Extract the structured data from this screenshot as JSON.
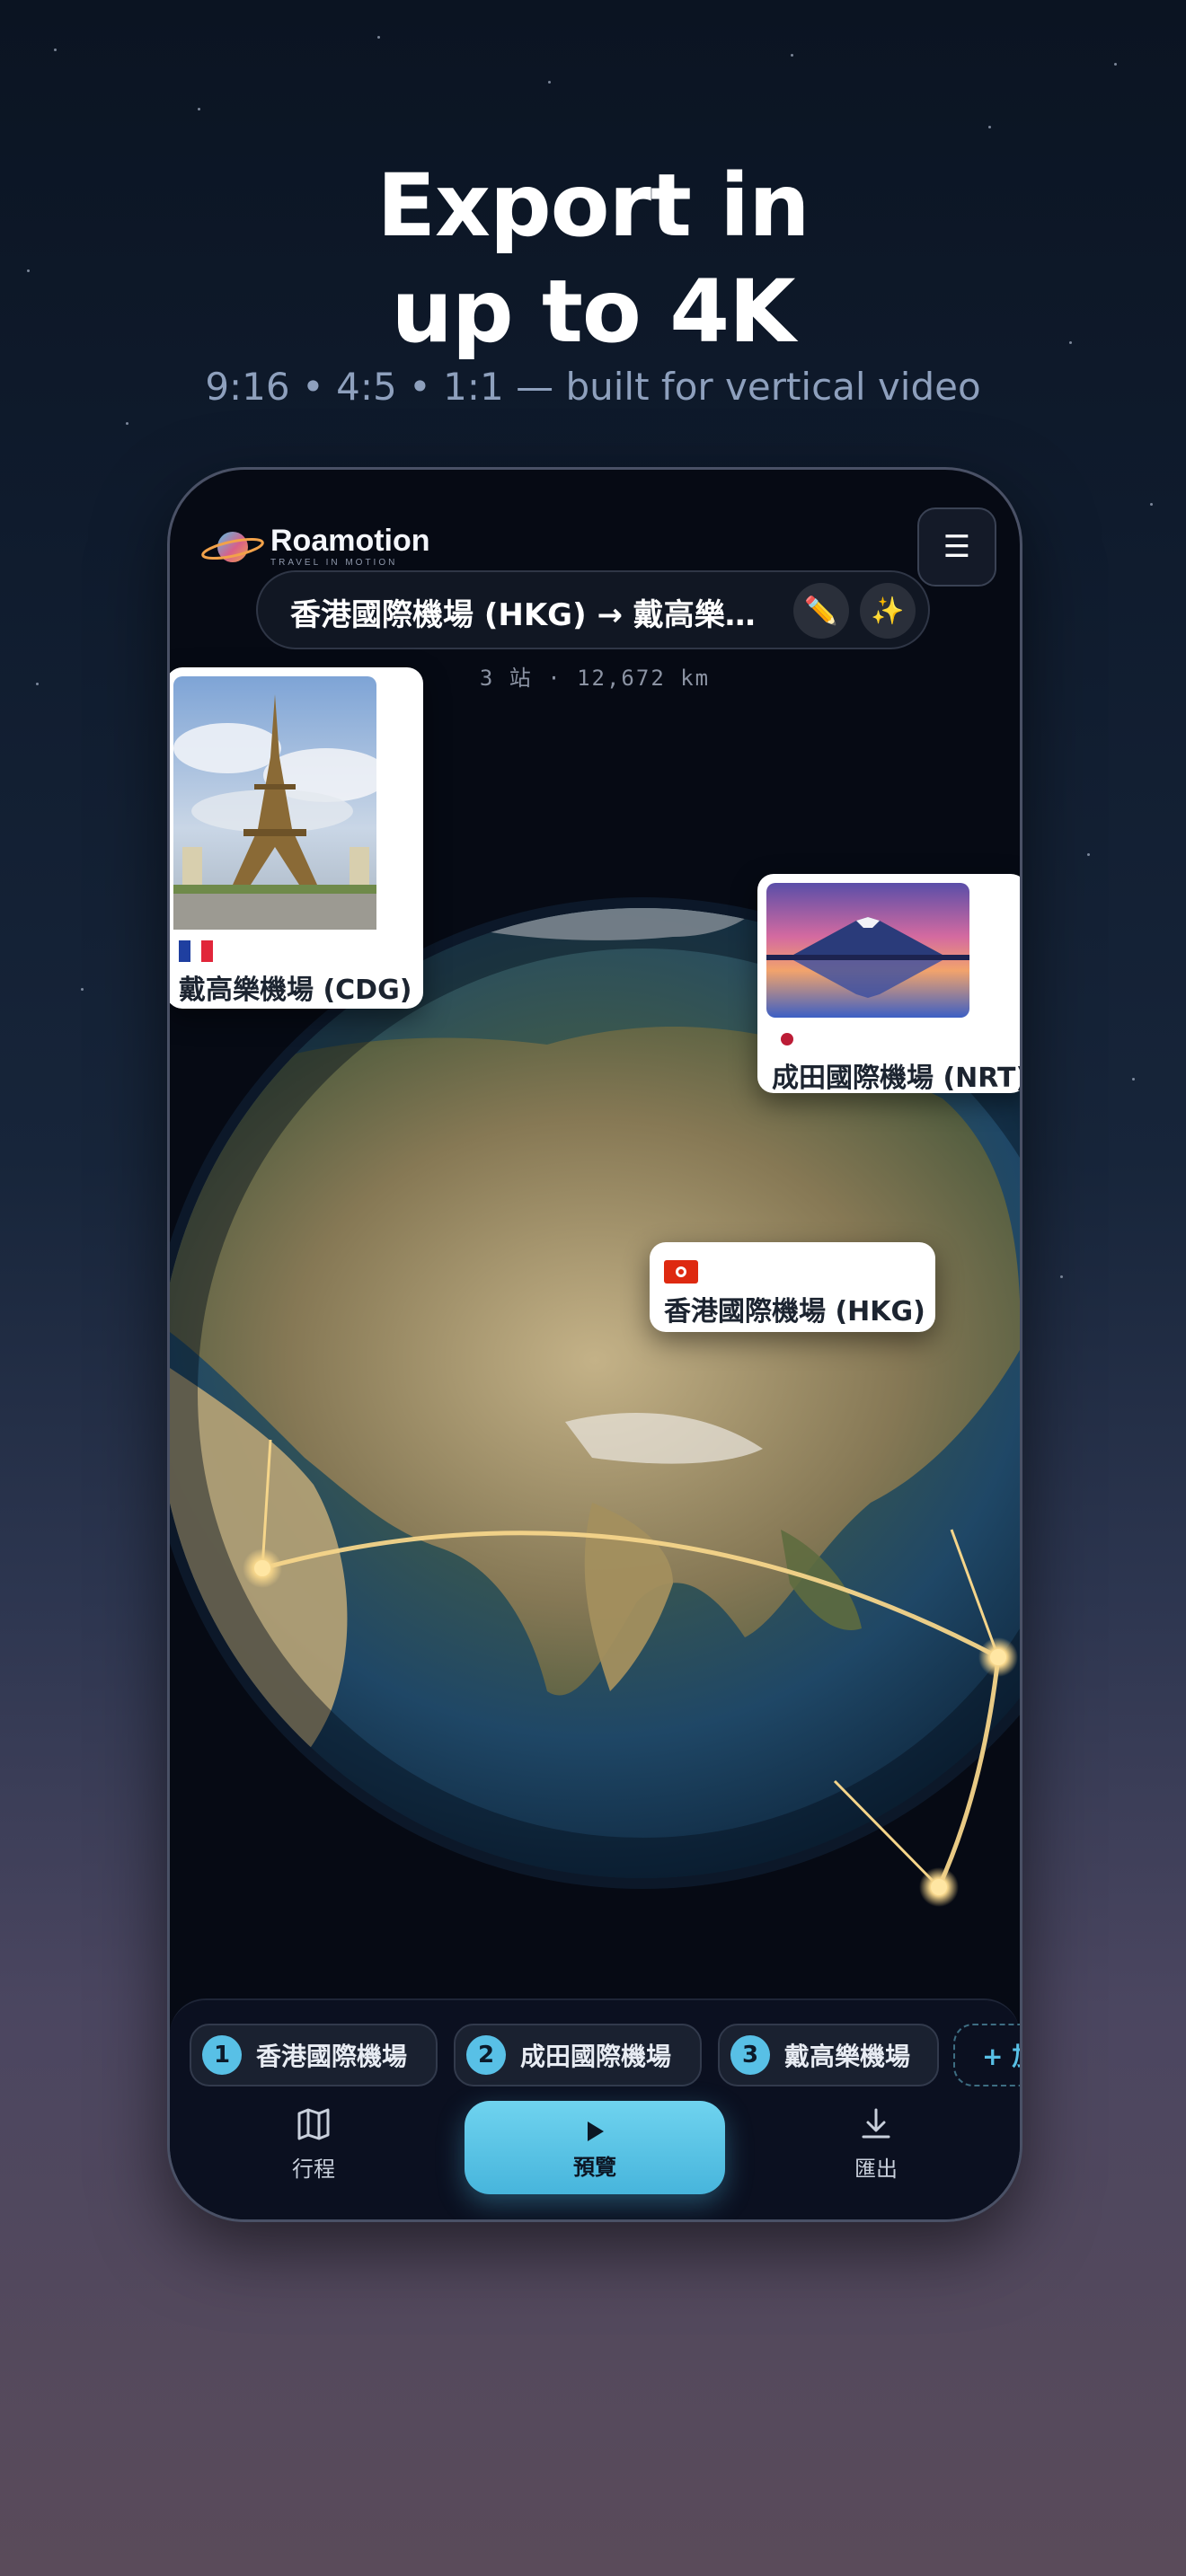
{
  "promo": {
    "headline_line1": "Export in",
    "headline_line2": "up to 4K",
    "subline": "9:16  •  4:5  •  1:1 — built for vertical video"
  },
  "app": {
    "brand_name": "Roamotion",
    "brand_tagline": "TRAVEL IN MOTION",
    "menu_icon": "☰",
    "trip_title": "香港國際機場 (HKG) → 戴高樂機場 (CDG)",
    "edit_icon": "✏️",
    "magic_icon": "✨",
    "trip_stats": "3 站 · 12,672 km"
  },
  "map": {
    "route_color": "#f5d58a",
    "cards": [
      {
        "name": "戴高樂機場 (CDG)",
        "flag": "france-flag"
      },
      {
        "name": "成田國際機場 (NRT)",
        "flag": "japan-flag"
      },
      {
        "name": "香港國際機場 (HKG)",
        "flag": "hong-kong-flag"
      }
    ]
  },
  "stops": [
    {
      "num": "1",
      "label": "香港國際機場"
    },
    {
      "num": "2",
      "label": "成田國際機場"
    },
    {
      "num": "3",
      "label": "戴高樂機場"
    }
  ],
  "add_stop_label": "+ 加",
  "nav": {
    "itinerary_label": "行程",
    "preview_label": "預覽",
    "export_label": "匯出"
  },
  "colors": {
    "accent": "#58c0e6",
    "background_top": "#0b1422",
    "background_bottom": "#5a4b5a"
  }
}
